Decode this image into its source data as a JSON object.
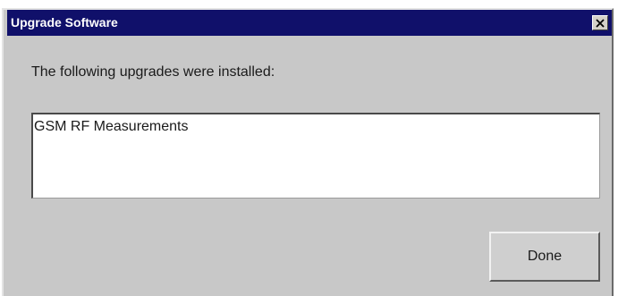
{
  "dialog": {
    "title": "Upgrade Software",
    "close_icon": "close-x-icon",
    "message": "The following upgrades were installed:",
    "installed_upgrades": [
      "GSM RF Measurements"
    ],
    "done_label": "Done"
  },
  "colors": {
    "title_bar": "#10106a",
    "dialog_background": "#c8c8c8",
    "list_background": "#ffffff"
  }
}
